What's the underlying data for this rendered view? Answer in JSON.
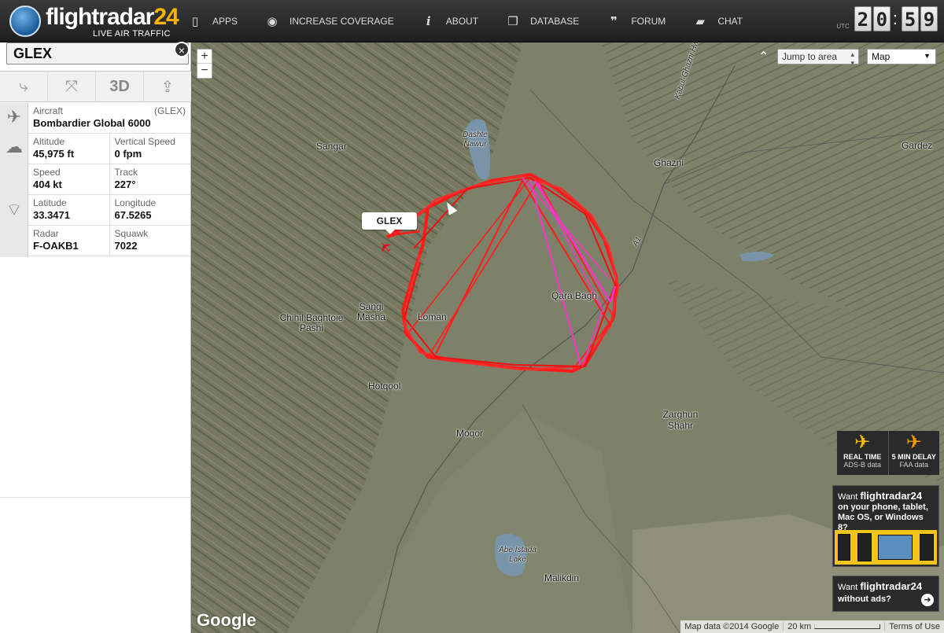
{
  "header": {
    "logo_word": "flightradar",
    "logo_num": "24",
    "logo_sub": "LIVE AIR TRAFFIC",
    "nav": [
      {
        "label": "APPS",
        "icon": "phone-icon",
        "glyph": "▯"
      },
      {
        "label": "INCREASE COVERAGE",
        "icon": "eye-icon",
        "glyph": "◉"
      },
      {
        "label": "ABOUT",
        "icon": "info-icon",
        "glyph": "i"
      },
      {
        "label": "DATABASE",
        "icon": "database-icon",
        "glyph": "❒"
      },
      {
        "label": "FORUM",
        "icon": "quote-icon",
        "glyph": "❞"
      },
      {
        "label": "CHAT",
        "icon": "chat-icon",
        "glyph": "▰"
      }
    ],
    "clock": {
      "utc_label": "UTC",
      "h1": "2",
      "h2": "0",
      "m1": "5",
      "m2": "9"
    }
  },
  "panel": {
    "search_value": "GLEX",
    "close_glyph": "×",
    "tools": [
      {
        "name": "route-icon",
        "glyph": "⤷"
      },
      {
        "name": "collapse-icon",
        "glyph": "⤧"
      },
      {
        "name": "3d-button",
        "glyph": "3D"
      },
      {
        "name": "share-icon",
        "glyph": "⇪"
      }
    ],
    "aircraft": {
      "label": "Aircraft",
      "code": "(GLEX)",
      "value": "Bombardier Global 6000"
    },
    "altitude": {
      "label": "Altitude",
      "value": "45,975 ft"
    },
    "vertical_speed": {
      "label": "Vertical Speed",
      "value": "0 fpm"
    },
    "speed": {
      "label": "Speed",
      "value": "404 kt"
    },
    "track": {
      "label": "Track",
      "value": "227°"
    },
    "latitude": {
      "label": "Latitude",
      "value": "33.3471"
    },
    "longitude": {
      "label": "Longitude",
      "value": "67.5265"
    },
    "radar": {
      "label": "Radar",
      "value": "F-OAKB1"
    },
    "squawk": {
      "label": "Squawk",
      "value": "7022"
    }
  },
  "map": {
    "zoom_in": "+",
    "zoom_out": "−",
    "jump_placeholder": "Jump to area",
    "map_type": "Map",
    "flight_label": "GLEX",
    "places": [
      {
        "name": "Sangar",
        "cls": ""
      },
      {
        "name": "Dashte Nawur",
        "cls": "small"
      },
      {
        "name": "Ghazni",
        "cls": ""
      },
      {
        "name": "Gardez",
        "cls": ""
      },
      {
        "name": "Qara Bagh",
        "cls": ""
      },
      {
        "name": "Sangi Masha",
        "cls": ""
      },
      {
        "name": "Chihil Baghtoie Pashi",
        "cls": ""
      },
      {
        "name": "Loman",
        "cls": ""
      },
      {
        "name": "Hotqool",
        "cls": ""
      },
      {
        "name": "Moqor",
        "cls": ""
      },
      {
        "name": "Zarghun Shahr",
        "cls": ""
      },
      {
        "name": "Abe Istada Lake",
        "cls": "small"
      },
      {
        "name": "Malikdin",
        "cls": ""
      },
      {
        "name": "Kabul-Ghazni Hwy",
        "cls": "small"
      },
      {
        "name": "A1",
        "cls": "small"
      }
    ],
    "google": "Google",
    "attribution": {
      "map_data": "Map data ©2014 Google",
      "scale": "20 km",
      "terms": "Terms of Use"
    }
  },
  "promo": {
    "realtime_title": "REAL TIME",
    "realtime_sub": "ADS-B data",
    "delay_title": "5 MIN DELAY",
    "delay_sub": "FAA data",
    "ad1_want": "Want",
    "ad1_brand": "flightradar24",
    "ad1_line": "on your phone, tablet, Mac OS, or Windows 8?",
    "ad2_want": "Want",
    "ad2_brand": "flightradar24",
    "ad2_line": "without ads?",
    "ad2_arrow": "➜"
  },
  "colors": {
    "track_red": "#ff1a1a",
    "track_magenta": "#ff33cc",
    "brand_yellow": "#f5b400"
  }
}
